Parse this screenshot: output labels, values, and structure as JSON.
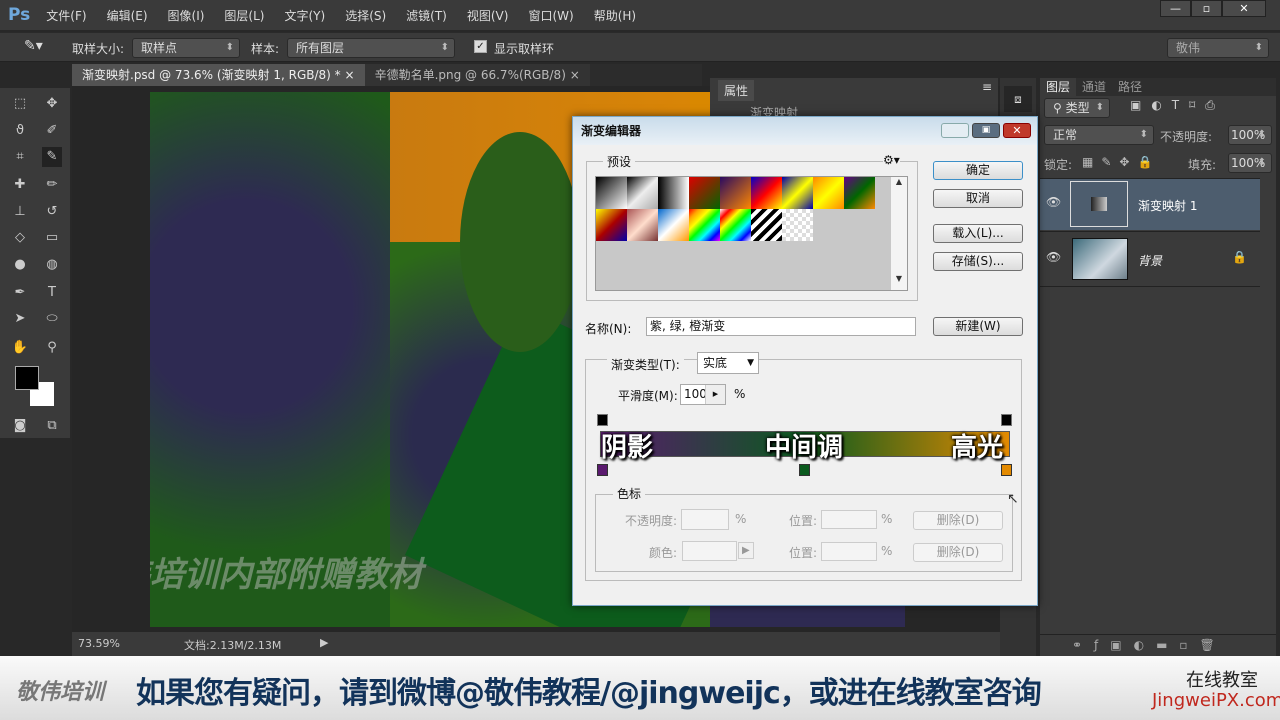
{
  "app": {
    "logo": "Ps",
    "menus": [
      "文件(F)",
      "编辑(E)",
      "图像(I)",
      "图层(L)",
      "文字(Y)",
      "选择(S)",
      "滤镜(T)",
      "视图(V)",
      "窗口(W)",
      "帮助(H)"
    ],
    "win_min": "—",
    "win_max": "▫",
    "win_close": "✕"
  },
  "options": {
    "sample_size_label": "取样大小:",
    "sample_size": "取样点",
    "sample_label": "样本:",
    "sample": "所有图层",
    "show_ring": "显示取样环",
    "workspace": "敬伟"
  },
  "tabs": [
    {
      "label": "渐变映射.psd @ 73.6% (渐变映射 1, RGB/8) *",
      "close": "×"
    },
    {
      "label": "辛德勒名单.png @ 66.7%(RGB/8)",
      "close": "×"
    }
  ],
  "status": {
    "zoom": "73.59%",
    "doc": "文档:2.13M/2.13M"
  },
  "watermark": "敬伟培训内部附赠教材",
  "properties": {
    "title": "属性",
    "item": "渐变映射"
  },
  "layers": {
    "tabs": [
      "图层",
      "通道",
      "路径"
    ],
    "filter": "类型",
    "blend": "正常",
    "opacity_label": "不透明度:",
    "opacity": "100%",
    "lock_label": "锁定:",
    "fill_label": "填充:",
    "fill": "100%",
    "items": [
      {
        "name": "渐变映射 1",
        "visible": true,
        "selected": true
      },
      {
        "name": "背景",
        "visible": true,
        "locked": true
      }
    ]
  },
  "dialog": {
    "title": "渐变编辑器",
    "presets_label": "预设",
    "ok": "确定",
    "cancel": "取消",
    "load": "载入(L)...",
    "save": "存储(S)...",
    "name_label": "名称(N):",
    "name_value": "紫, 绿, 橙渐变",
    "new": "新建(W)",
    "type_label": "渐变类型(T):",
    "type_value": "实底",
    "smooth_label": "平滑度(M):",
    "smooth_value": "100",
    "percent": "%",
    "overlay": {
      "shadow": "阴影",
      "mid": "中间调",
      "high": "高光"
    },
    "stops_label": "色标",
    "opacity_label": "不透明度:",
    "color_label": "颜色:",
    "position_label": "位置:",
    "delete": "删除(D)",
    "colors": {
      "purple": "#5a1a6e",
      "green": "#0b5a1e",
      "orange": "#e38a00"
    }
  },
  "banner": {
    "brand": "敬伟培训",
    "message": "如果您有疑问，请到微博@敬伟教程/@jingweijc，或进在线教室咨询",
    "online": "在线教室",
    "site": "JingweiPX.com"
  }
}
